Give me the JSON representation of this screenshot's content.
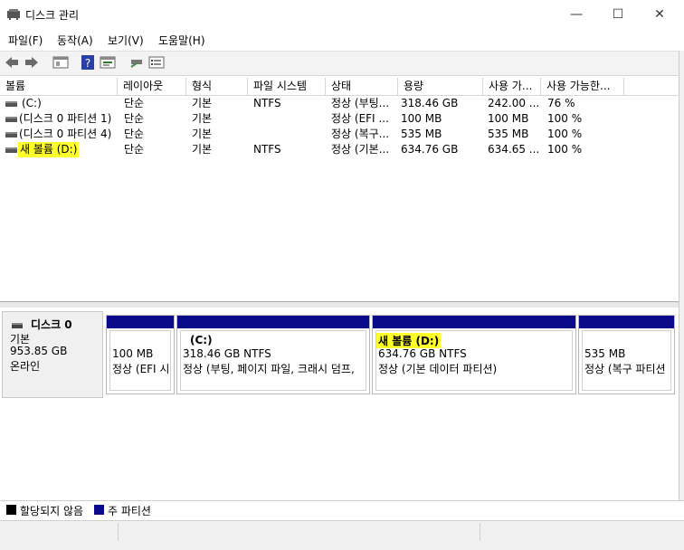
{
  "window": {
    "title": "디스크 관리",
    "minimize": "—",
    "maximize": "☐",
    "close": "✕"
  },
  "menu": [
    "파일(F)",
    "동작(A)",
    "보기(V)",
    "도움말(H)"
  ],
  "toolbar_icons": [
    "back-icon",
    "forward-icon",
    "view-icon",
    "help-icon",
    "properties-icon",
    "connect-icon",
    "list-icon"
  ],
  "list": {
    "columns": [
      "볼륨",
      "레이아웃",
      "형식",
      "파일 시스템",
      "상태",
      "용량",
      "사용 가...",
      "사용 가능한..."
    ],
    "rows": [
      {
        "volume": "(C:)",
        "layout": "단순",
        "type": "기본",
        "fs": "NTFS",
        "status": "정상 (부팅...",
        "capacity": "318.46 GB",
        "free": "242.00 ...",
        "pct": "76 %"
      },
      {
        "volume": "(디스크 0 파티션 1)",
        "layout": "단순",
        "type": "기본",
        "fs": "",
        "status": "정상 (EFI ...",
        "capacity": "100 MB",
        "free": "100 MB",
        "pct": "100 %"
      },
      {
        "volume": "(디스크 0 파티션 4)",
        "layout": "단순",
        "type": "기본",
        "fs": "",
        "status": "정상 (복구...",
        "capacity": "535 MB",
        "free": "535 MB",
        "pct": "100 %"
      },
      {
        "volume": "새 볼륨 (D:)",
        "layout": "단순",
        "type": "기본",
        "fs": "NTFS",
        "status": "정상 (기본...",
        "capacity": "634.76 GB",
        "free": "634.65 ...",
        "pct": "100 %"
      }
    ]
  },
  "disk": {
    "name": "디스크 0",
    "kind": "기본",
    "size": "953.85 GB",
    "state": "온라인",
    "partitions": [
      {
        "title": "",
        "size": "100 MB",
        "status": "정상 (EFI 시"
      },
      {
        "title": "(C:)",
        "size": "318.46 GB NTFS",
        "status": "정상 (부팅, 페이지 파일, 크래시 덤프,"
      },
      {
        "title": "새 볼륨  (D:)",
        "size": "634.76 GB NTFS",
        "status": "정상 (기본 데이터 파티션)"
      },
      {
        "title": "",
        "size": "535 MB",
        "status": "정상 (복구 파티션"
      }
    ]
  },
  "legend": {
    "unallocated": "할당되지 않음",
    "primary": "주 파티션",
    "unallocated_color": "#000000",
    "primary_color": "#0a0a8a"
  },
  "colors": {
    "highlight": "#ffff2a",
    "partition_bar": "#0a0a8a"
  }
}
